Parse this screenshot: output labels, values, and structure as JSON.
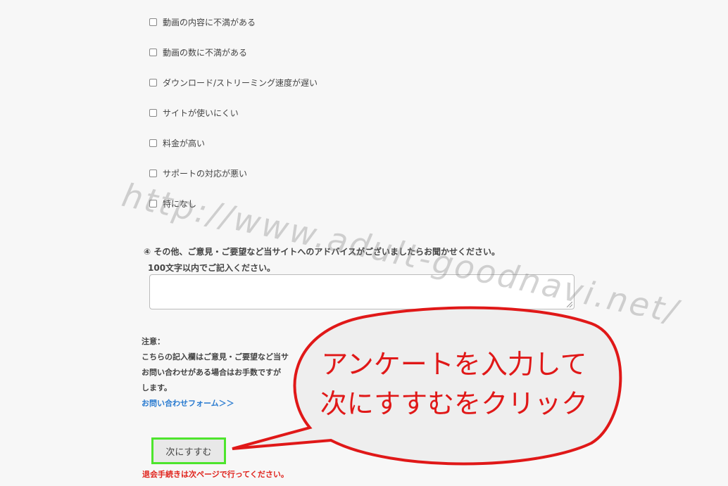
{
  "survey": {
    "options": [
      "動画の内容に不満がある",
      "動画の数に不満がある",
      "ダウンロード/ストリーミング速度が遅い",
      "サイトが使いにくい",
      "料金が高い",
      "サポートの対応が悪い",
      "特になし"
    ],
    "question4": "④ その他、ご意見・ご要望など当サイトへのアドバイスがございましたらお聞かせください。",
    "question4_sub": "100文字以内でご記入ください。",
    "comment_value": ""
  },
  "note": {
    "heading": "注意：",
    "line1": "こちらの記入欄はご意見・ご要望など当サ",
    "line2": "お問い合わせがある場合はお手数ですが",
    "line3": "します。",
    "contact_link": "お問い合わせフォーム＞＞"
  },
  "next_button_label": "次にすすむ",
  "withdraw_note": "退会手続きは次ページで行ってください。",
  "watermark": "http://www.adult-goodnavi.net/",
  "callout": {
    "line1": "アンケートを入力して",
    "line2": "次にすすむをクリック"
  },
  "colors": {
    "highlight_border": "#4ee52d",
    "callout_stroke": "#e01818",
    "callout_fill": "#eeeeee",
    "link": "#2a7bd0",
    "warning_text": "#e0231c"
  }
}
